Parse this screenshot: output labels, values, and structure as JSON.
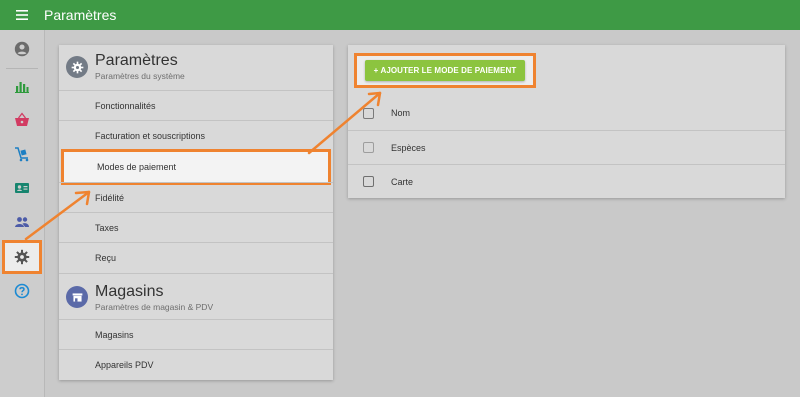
{
  "app": {
    "title": "Paramètres"
  },
  "colors": {
    "topbar": "#3e9a45",
    "accent_button": "#8cc43f",
    "highlight": "#ef8330"
  },
  "sidebar": {
    "items": [
      {
        "name": "account-icon",
        "color": "#6b6b6b"
      },
      {
        "name": "reports-icon",
        "color": "#2e9a3c"
      },
      {
        "name": "sales-basket-icon",
        "color": "#d23b62"
      },
      {
        "name": "inventory-cart-icon",
        "color": "#1d7fc3"
      },
      {
        "name": "customers-card-icon",
        "color": "#17856f"
      },
      {
        "name": "employees-icon",
        "color": "#4c5ba8"
      },
      {
        "name": "settings-gear-icon",
        "color": "#555555",
        "active": true
      },
      {
        "name": "help-icon",
        "color": "#1b8ad3"
      }
    ]
  },
  "settings": {
    "title": "Paramètres",
    "subtitle": "Paramètres du système",
    "items": [
      {
        "label": "Fonctionnalités"
      },
      {
        "label": "Facturation et souscriptions"
      },
      {
        "label": "Modes de paiement",
        "active": true
      },
      {
        "label": "Fidélité"
      },
      {
        "label": "Taxes"
      },
      {
        "label": "Reçu"
      }
    ]
  },
  "stores": {
    "title": "Magasins",
    "subtitle": "Paramètres de magasin & PDV",
    "items": [
      {
        "label": "Magasins"
      },
      {
        "label": "Appareils PDV"
      }
    ]
  },
  "payment_modes": {
    "add_button": "+ AJOUTER LE MODE DE PAIEMENT",
    "header": "Nom",
    "rows": [
      {
        "name": "Espèces"
      },
      {
        "name": "Carte"
      }
    ]
  }
}
